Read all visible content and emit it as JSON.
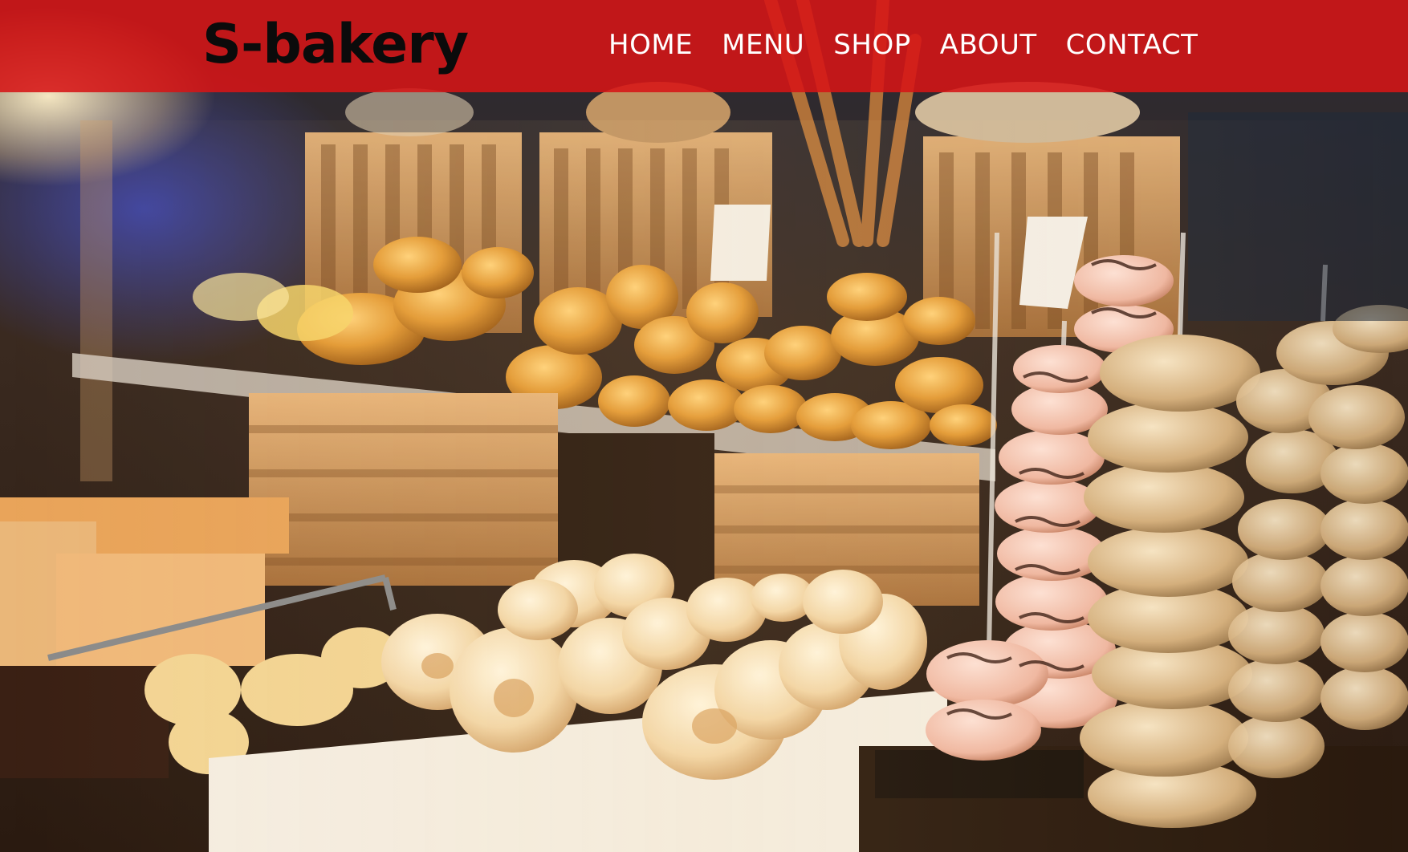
{
  "brand": {
    "logo_text": "S-bakery"
  },
  "nav": {
    "items": [
      {
        "label": "HOME"
      },
      {
        "label": "MENU"
      },
      {
        "label": "SHOP"
      },
      {
        "label": "ABOUT"
      },
      {
        "label": "CONTACT"
      }
    ]
  },
  "colors": {
    "navbar_bg": "#D61416",
    "logo_text": "#0B0B0B",
    "nav_text": "#FFFFFF"
  }
}
